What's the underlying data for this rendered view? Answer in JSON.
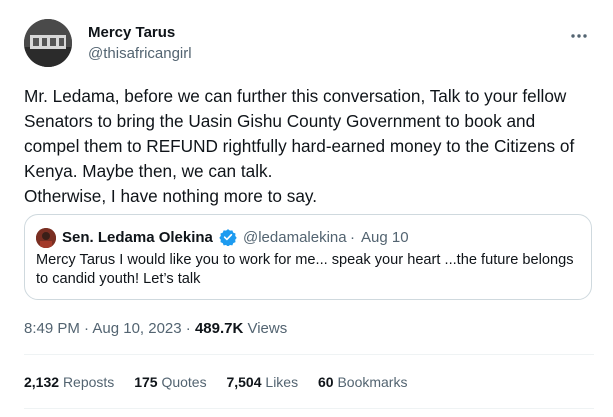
{
  "author": {
    "name": "Mercy Tarus",
    "handle": "@thisafricangirl"
  },
  "tweet_text": "Mr. Ledama, before we can further this conversation, Talk to your fellow\nSenators to bring the Uasin Gishu County Government to book and\ncompel them to REFUND rightfully hard-earned money to the Citizens of\nKenya. Maybe then, we can talk.\nOtherwise, I have nothing more to say.",
  "quoted": {
    "name": "Sen. Ledama Olekina",
    "handle": "@ledamalekina",
    "separator": "·",
    "date": "Aug 10",
    "text": "Mercy Tarus I would like you to work for me... speak your heart ...the future belongs to candid youth! Let’s talk",
    "verified_color": "#1d9bf0"
  },
  "meta": {
    "time_date": "8:49 PM · Aug 10, 2023 · ",
    "views_count": "489.7K",
    "views_label": " Views"
  },
  "stats": {
    "reposts_count": "2,132",
    "reposts_label": "Reposts",
    "quotes_count": "175",
    "quotes_label": "Quotes",
    "likes_count": "7,504",
    "likes_label": "Likes",
    "bookmarks_count": "60",
    "bookmarks_label": "Bookmarks"
  },
  "icons": {
    "more": "more-dots-icon",
    "verified": "verified-badge-icon"
  }
}
